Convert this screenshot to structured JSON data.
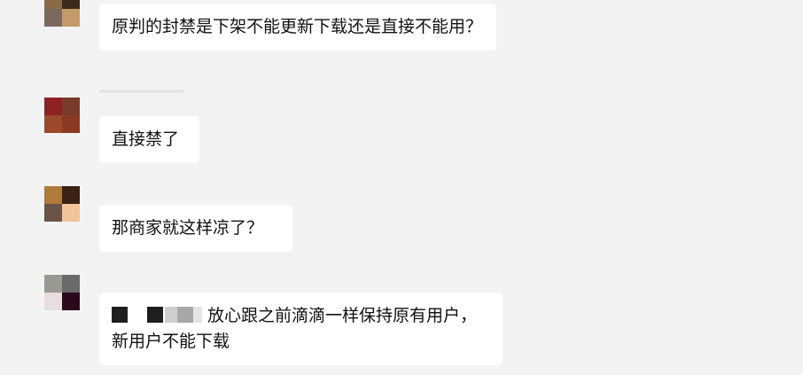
{
  "chat": {
    "messages": [
      {
        "text": "原判的封禁是下架不能更新下载还是直接不能用？",
        "avatar_colors": [
          "#8b6a4a",
          "#3a2a1a",
          "#7a6a60",
          "#c49a6a"
        ]
      },
      {
        "text": "直接禁了",
        "avatar_colors": [
          "#8e2222",
          "#7a3a2a",
          "#9a4a2a",
          "#8a3a22"
        ]
      },
      {
        "text": "那商家就这样凉了？",
        "avatar_colors": [
          "#b07a3a",
          "#3a2214",
          "#6a5448",
          "#f2c49a"
        ]
      },
      {
        "text_visible": "放心跟之前滴滴一样保持原有用户，新用户不能下载",
        "avatar_colors": [
          "#9a9a94",
          "#6a6a6a",
          "#e8dde0",
          "#2a0a1a"
        ]
      }
    ]
  }
}
